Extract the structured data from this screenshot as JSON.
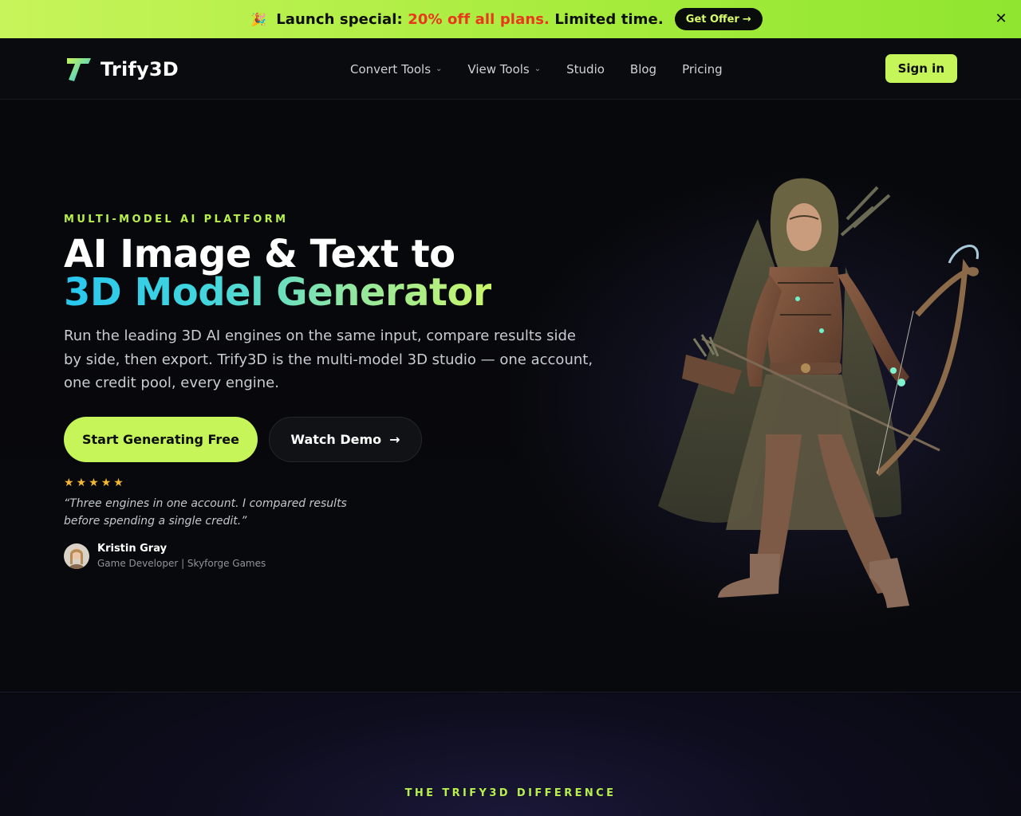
{
  "promo": {
    "emoji": "🎉",
    "text_before": "Launch special: ",
    "highlight": "20% off all plans.",
    "text_after": " Limited time.",
    "button_label": "Get Offer",
    "button_arrow": "→",
    "close_glyph": "✕"
  },
  "nav": {
    "brand": "Trify3D",
    "items": [
      {
        "label": "Convert Tools",
        "dropdown": true
      },
      {
        "label": "View Tools",
        "dropdown": true
      },
      {
        "label": "Studio",
        "dropdown": false
      },
      {
        "label": "Blog",
        "dropdown": false
      },
      {
        "label": "Pricing",
        "dropdown": false
      }
    ],
    "chevron": "⌄",
    "signin_label": "Sign in"
  },
  "hero": {
    "eyebrow": "MULTI-MODEL AI PLATFORM",
    "title_line1": "AI Image & Text to",
    "title_line2": "3D Model Generator",
    "subtitle": "Run the leading 3D AI engines on the same input, compare results side by side, then export. Trify3D is the multi-model 3D studio — one account, one credit pool, every engine.",
    "primary_cta": "Start Generating Free",
    "secondary_cta": "Watch Demo",
    "secondary_arrow": "→",
    "rating_stars": 5,
    "star_glyph": "★",
    "quote": "“Three engines in one account. I compared results before spending a single credit.”",
    "author_name": "Kristin Gray",
    "author_role": "Game Developer | Skyforge Games"
  },
  "section2": {
    "label": "THE TRIFY3D DIFFERENCE"
  },
  "colors": {
    "accent": "#c6f55a",
    "promo_highlight": "#e8391b",
    "star": "#f5b731",
    "background": "#07080b"
  }
}
